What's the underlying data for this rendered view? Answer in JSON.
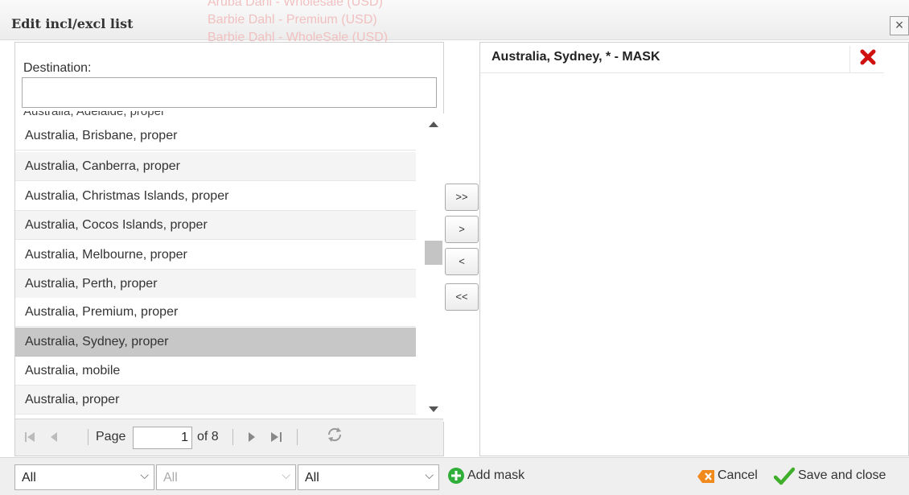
{
  "dialog": {
    "title": "Edit incl/excl list",
    "background_text": [
      "Aruba Dahl - Wholesale (USD)",
      "Barbie Dahl - Premium (USD)",
      "Barbie Dahl - WholeSale (USD)"
    ],
    "close_symbol": "×"
  },
  "left": {
    "destination_label": "Destination:",
    "destination_value": "",
    "cut_row": "Australia, Adelaide, proper",
    "rows": [
      {
        "label": "Australia, Brisbane, proper"
      },
      {
        "label": "Australia, Canberra, proper"
      },
      {
        "label": "Australia, Christmas Islands, proper"
      },
      {
        "label": "Australia, Cocos Islands, proper"
      },
      {
        "label": "Australia, Melbourne, proper"
      },
      {
        "label": "Australia, Perth, proper"
      },
      {
        "label": "Australia, Premium, proper"
      },
      {
        "label": "Australia, Sydney, proper",
        "selected": true
      },
      {
        "label": "Australia, mobile"
      },
      {
        "label": "Australia, proper"
      }
    ],
    "pager": {
      "page_label": "Page",
      "page_value": "1",
      "of_label": "of 8"
    }
  },
  "transfer": {
    "add_all": ">>",
    "add": ">",
    "remove": "<",
    "remove_all": "<<"
  },
  "right": {
    "items": [
      {
        "label": "Australia, Sydney, * - MASK"
      }
    ]
  },
  "footer": {
    "filters": [
      {
        "value": "All",
        "enabled": true
      },
      {
        "value": "All",
        "enabled": false
      },
      {
        "value": "All",
        "enabled": true
      }
    ],
    "add_mask": "Add mask",
    "cancel": "Cancel",
    "save": "Save and close"
  },
  "colors": {
    "delete": "#d11010",
    "add": "#2fae3a",
    "cancel": "#f08a1c",
    "check": "#3fae2a",
    "selected_row": "#c7c7c7"
  }
}
